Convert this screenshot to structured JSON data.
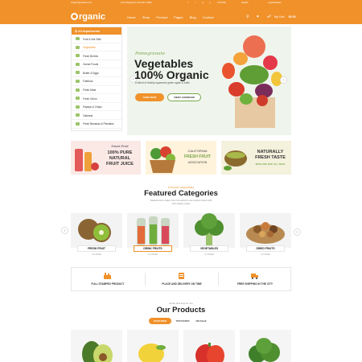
{
  "topbar": {
    "email": "Organic@website.com",
    "shipping": "Free Shipping for all Order of $99",
    "currency": "US Dollar",
    "language": "English",
    "login": "Login/Register"
  },
  "header": {
    "logo": "rganic",
    "nav": [
      "Home",
      "Shop",
      "Product",
      "Pages",
      "Blog",
      "Contact"
    ],
    "cart_label": "My Cart",
    "cart_total": "$0.00"
  },
  "sidebar": {
    "title": "All departments",
    "items": [
      {
        "label": "Fruit & Nut Gifts",
        "active": false
      },
      {
        "label": "Vegetables",
        "active": true
      },
      {
        "label": "Fresh Berries",
        "active": false
      },
      {
        "label": "Ocean Foods",
        "active": false
      },
      {
        "label": "Butter & Eggs",
        "active": false
      },
      {
        "label": "Fastfood",
        "active": false
      },
      {
        "label": "Fresh Meat",
        "active": false
      },
      {
        "label": "Fresh Onion",
        "active": false
      },
      {
        "label": "Papaya & Crisps",
        "active": false
      },
      {
        "label": "Oatmeal",
        "active": false
      },
      {
        "label": "Fresh Bananas & Plantains",
        "active": false
      }
    ]
  },
  "hero": {
    "subtitle": "Pomegranate",
    "title_line1": "Vegetables",
    "title_line2": "100% Organic",
    "description": "A blend of freshly squeezed green apple & fruits",
    "shop_button": "SHOP NOW",
    "lookbook_button": "VIEW LOOKBOOK"
  },
  "banners": [
    {
      "kicker": "Smoot Fruit",
      "line1": "100% PURE",
      "line2": "NATURAL",
      "line3": "FRUIT JUICE"
    },
    {
      "kicker": "CALIFORNIA",
      "line1": "FRESH FRUIT",
      "line2": "ASSOCIATION"
    },
    {
      "line1": "NATURALLY",
      "line2": "FRESH TASTE",
      "line3": "WITH 25% OFF ALL TEAS"
    }
  ],
  "categories": {
    "kicker": "POPULAR CATEGORIES",
    "title": "Featured Categories",
    "description_line1": "Natural food is taken from the world's most modern farms with",
    "description_line2": "strict safety cycles",
    "items": [
      {
        "name": "FRESH FRUIT",
        "count": "1 in Order"
      },
      {
        "name": "DRINK FRUITS",
        "count": "1 in Order"
      },
      {
        "name": "VEGETABLES",
        "count": "1 in Order"
      },
      {
        "name": "DRIED FRUITS",
        "count": "1 in Order"
      }
    ]
  },
  "features": [
    {
      "label": "FULL STAMPED PRODUCT"
    },
    {
      "label": "PLACE AND DELIVERY ON TIME"
    },
    {
      "label": "FREE SHIPPING IN THE CITY"
    }
  ],
  "products": {
    "kicker": "All the best item for You",
    "title": "Our Products",
    "tabs": [
      {
        "label": "FEATURED",
        "active": true
      },
      {
        "label": "TOP RATED",
        "active": false
      },
      {
        "label": "ON SALE",
        "active": false
      }
    ]
  },
  "colors": {
    "accent": "#f0912a",
    "green": "#7aa64a",
    "hero_bg": "#eff5ec"
  }
}
